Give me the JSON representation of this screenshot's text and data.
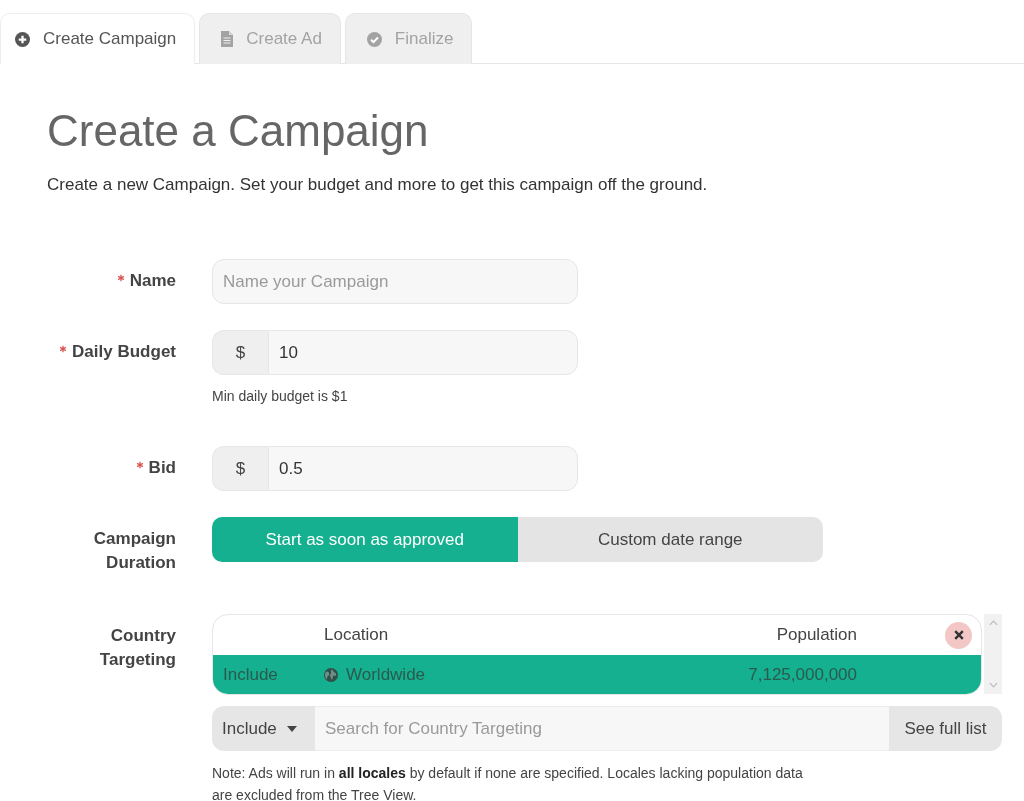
{
  "tabs": [
    {
      "label": "Create Campaign",
      "selected": true
    },
    {
      "label": "Create Ad",
      "selected": false
    },
    {
      "label": "Finalize",
      "selected": false
    }
  ],
  "page": {
    "title": "Create a Campaign",
    "description": "Create a new Campaign. Set your budget and more to get this campaign off the ground."
  },
  "form": {
    "fields": [
      {
        "kind": "text",
        "label": "Name",
        "required": true,
        "placeholder": "Name your Campaign"
      },
      {
        "kind": "currency",
        "label": "Daily Budget",
        "required": true,
        "prefix": "$",
        "value": "10",
        "hint": "Min daily budget is $1"
      },
      {
        "kind": "currency",
        "label": "Bid",
        "required": true,
        "prefix": "$",
        "value": "0.5"
      },
      {
        "kind": "segmented",
        "label": "Campaign Duration",
        "options": [
          {
            "label": "Start as soon as approved",
            "selected": true
          },
          {
            "label": "Custom date range",
            "selected": false
          }
        ]
      },
      {
        "kind": "targeting",
        "label": "Country Targeting",
        "columns": [
          "Location",
          "Population"
        ],
        "rows": [
          {
            "mode": "Include",
            "location": "Worldwide",
            "population": "7,125,000,000",
            "selected": true
          }
        ],
        "search": {
          "mode": "Include",
          "placeholder": "Search for Country Targeting",
          "button": "See full list"
        },
        "note": "Note: Ads will run in **all locales** by default if none are specified. Locales lacking population data are excluded from the Tree View."
      }
    ]
  }
}
